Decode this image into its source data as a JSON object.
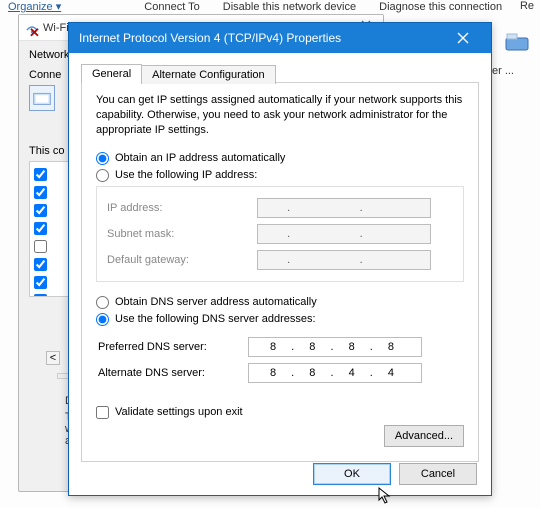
{
  "bg": {
    "organize": "Organize ▾",
    "connectTo": "Connect To",
    "disable": "Disable this network device",
    "diagnose": "Diagnose this connection",
    "re": "Re",
    "pter": "pter ..."
  },
  "wifi": {
    "title": "Wi-Fi Properties",
    "tabNetworking": "Network",
    "connectUsing": "Conne",
    "thisConn": "This co",
    "desc": "Desc",
    "traWide": "Trai",
    "wide": "wide",
    "acro": "acro",
    "checks": [
      true,
      true,
      true,
      true,
      false,
      true,
      true,
      true
    ]
  },
  "ipv4": {
    "title": "Internet Protocol Version 4 (TCP/IPv4) Properties",
    "tabs": {
      "general": "General",
      "alt": "Alternate Configuration"
    },
    "desc": "You can get IP settings assigned automatically if your network supports this capability. Otherwise, you need to ask your network administrator for the appropriate IP settings.",
    "ipAuto": "Obtain an IP address automatically",
    "ipManual": "Use the following IP address:",
    "ipFields": {
      "ip": "IP address:",
      "mask": "Subnet mask:",
      "gw": "Default gateway:"
    },
    "dnsAuto": "Obtain DNS server address automatically",
    "dnsManual": "Use the following DNS server addresses:",
    "dnsFields": {
      "pref": "Preferred DNS server:",
      "alt": "Alternate DNS server:",
      "prefVal": "8 . 8 . 8 . 8",
      "altVal": "8 . 8 . 4 . 4"
    },
    "validate": "Validate settings upon exit",
    "advanced": "Advanced...",
    "ok": "OK",
    "cancel": "Cancel"
  }
}
